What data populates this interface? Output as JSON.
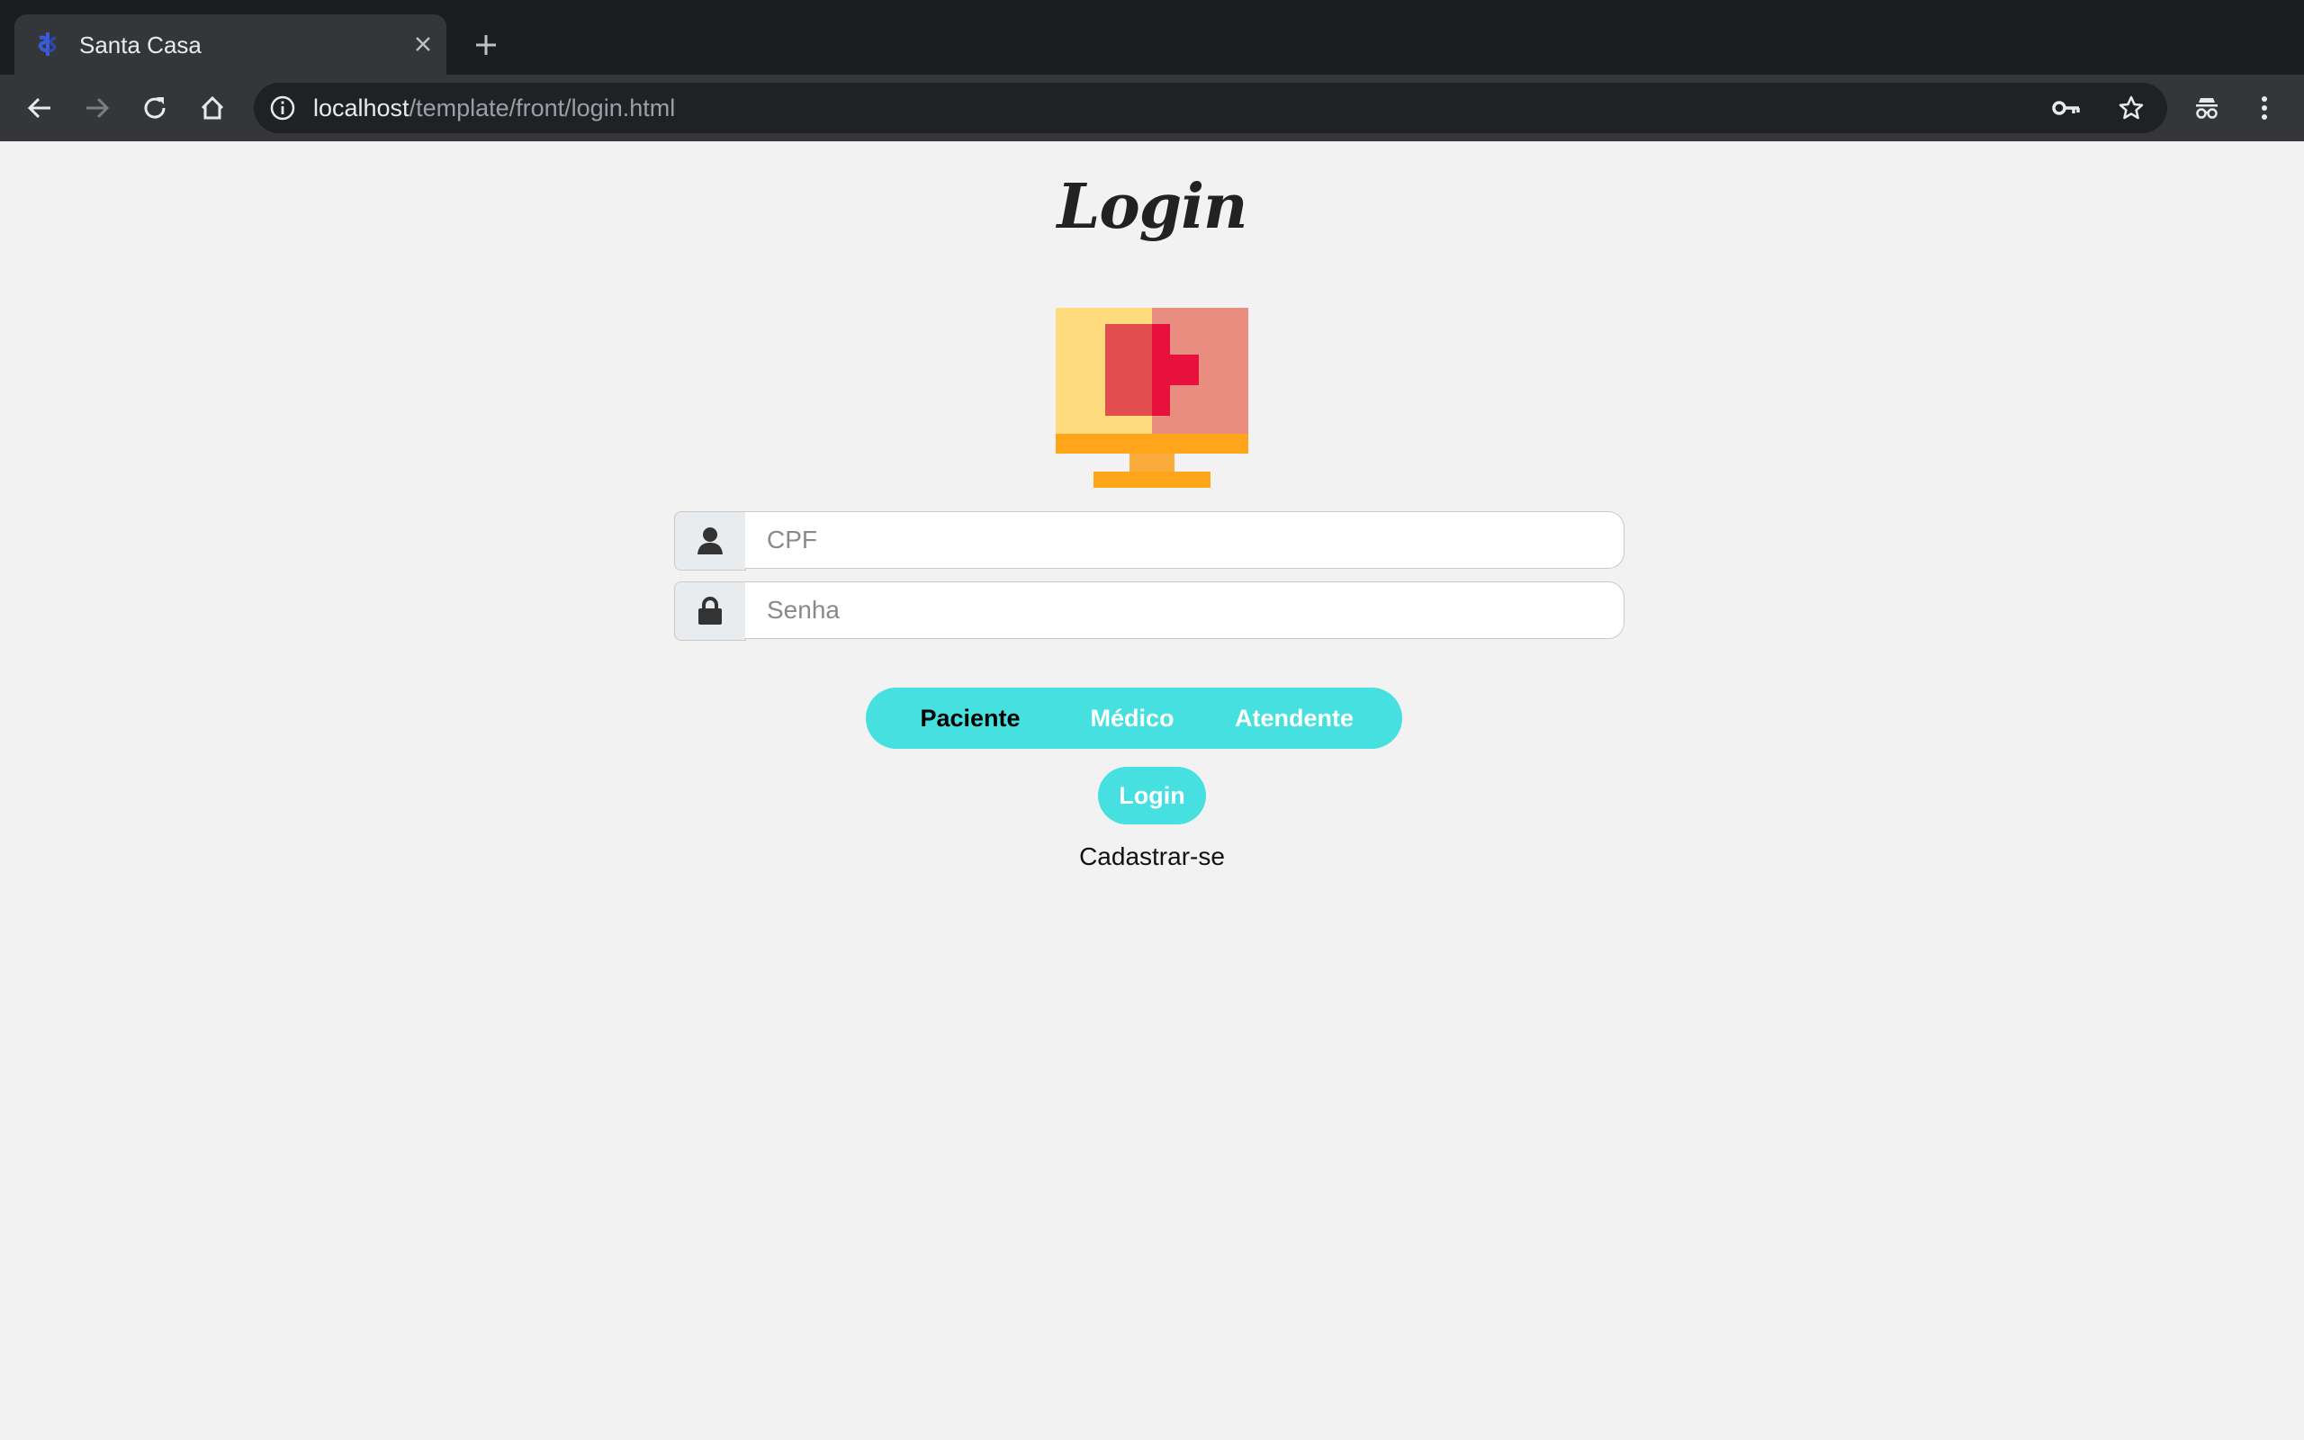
{
  "browser": {
    "tab": {
      "title": "Santa Casa"
    },
    "address": {
      "host": "localhost",
      "path": "/template/front/login.html"
    }
  },
  "page": {
    "title": "Login",
    "form": {
      "cpf_placeholder": "CPF",
      "password_placeholder": "Senha"
    },
    "roles": [
      "Paciente",
      "Médico",
      "Atendente"
    ],
    "selected_role": "Paciente",
    "login_label": "Login",
    "signup_label": "Cadastrar-se"
  },
  "colors": {
    "accent": "#47e0e0",
    "chrome_dark": "#1c1d20",
    "chrome_toolbar": "#35363a",
    "page_bg": "#f2f2f2"
  },
  "icons": {
    "favicon": "caduceus-icon",
    "logo": "medical-monitor-icon",
    "cpf_addon": "user-icon",
    "password_addon": "lock-icon"
  }
}
